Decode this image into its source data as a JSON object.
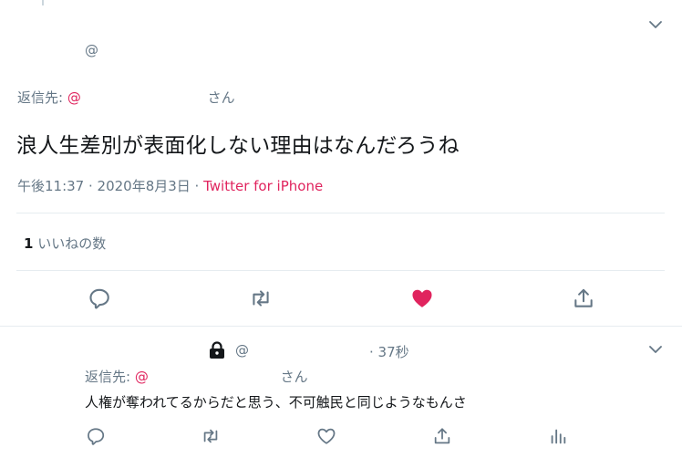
{
  "main_tweet": {
    "username_prefix": "@",
    "replying_to_label": "返信先:",
    "replying_to_at": "@",
    "replying_to_suffix": "さん",
    "text": "浪人生差別が表面化しない理由はなんだろうね",
    "timestamp": "午後11:37 · 2020年8月3日 · ",
    "source": "Twitter for iPhone",
    "likes_count": "1",
    "likes_label": "いいねの数"
  },
  "reply_tweet": {
    "username_prefix": "@",
    "time": "· 37秒",
    "replying_to_label": "返信先:",
    "replying_to_at": "@",
    "replying_to_suffix": "さん",
    "text": "人権が奪われてるからだと思う、不可触民と同じようなもんさ"
  },
  "colors": {
    "accent": "#e0245e",
    "muted": "#657786",
    "divider": "#e6ecf0",
    "text": "#14171a"
  },
  "icons": [
    "chevron-down-icon",
    "reply-icon",
    "retweet-icon",
    "heart-filled-icon",
    "share-icon",
    "lock-icon",
    "heart-outline-icon",
    "analytics-icon"
  ]
}
